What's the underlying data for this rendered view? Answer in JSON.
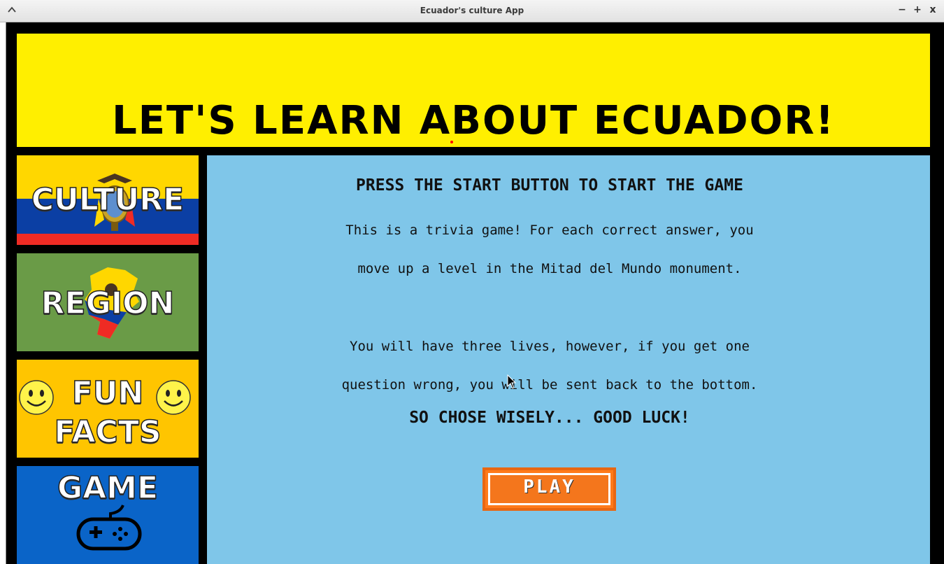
{
  "window": {
    "title": "Ecuador's culture App",
    "minimize_label": "−",
    "maximize_label": "+",
    "close_label": "x"
  },
  "banner": {
    "heading": "LET'S LEARN ABOUT ECUADOR!"
  },
  "nav": {
    "culture": "CULTURE",
    "region": "REGION",
    "fun_facts_line1": "FUN",
    "fun_facts_line2": "FACTS",
    "game": "GAME"
  },
  "content": {
    "heading": "PRESS THE START BUTTON TO START THE GAME",
    "para1_line1": "This is a trivia game! For each correct answer, you",
    "para1_line2": "move up a level in the Mitad del Mundo monument.",
    "para2_line1": "You will have three lives, however, if you get one",
    "para2_line2": "question wrong, you will be sent back to the bottom.",
    "closing": "SO CHOSE WISELY... GOOD LUCK!",
    "play_label": "PLAY"
  },
  "colors": {
    "banner": "#ffef00",
    "panel": "#7fc6e9",
    "culture_yellow": "#ffd700",
    "culture_blue": "#0b3fa4",
    "culture_red": "#ef2b24",
    "region_green": "#6a9b47",
    "fun_yellow": "#ffc500",
    "game_blue": "#0a64c8",
    "play_orange": "#f4761c"
  },
  "icons": [
    "chevron-up-icon",
    "coat-of-arms-icon",
    "ecuador-map-icon",
    "smiley-icon",
    "gamepad-icon",
    "mouse-cursor-icon"
  ]
}
